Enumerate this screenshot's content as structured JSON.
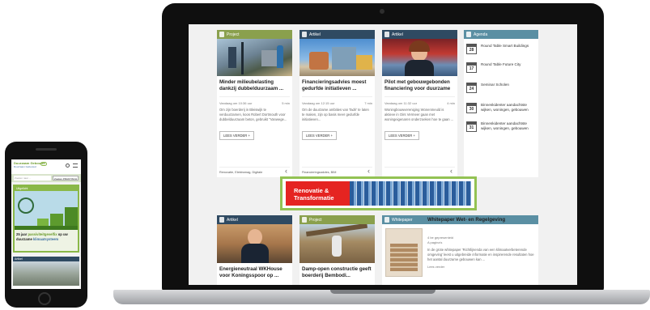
{
  "laptop": {
    "cards": [
      {
        "type": "Project",
        "head_color": "#8aa04d",
        "title": "Minder milieubelasting dankzij dubbelduurzaam ...",
        "date": "Vandaag om 10:36 uur",
        "read_time": "5 min",
        "text": "Om zijn boerderij in Bleiswijk te verduurzamen, koos Robert Dortmouth voor dubbelduurzaam  beton, gebruikt \"Vanwege...",
        "button": "LEES VERDER +",
        "tags": "Renovatie, Elektromag, Digitale"
      },
      {
        "type": "Artikel",
        "head_color": "#2f4a62",
        "title": "Financieringsadvies moest gedurfde initiatieven ...",
        "date": "Vandaag om 12:15 uur",
        "read_time": "7 min",
        "text": "Om de duurzame ambities van Tadri' te laten te maken, zijn op basis meer gedurfde initiatieven...",
        "button": "LEES VERDER +",
        "tags": "Financieringsadvies, BIM"
      },
      {
        "type": "Artikel",
        "head_color": "#2f4a62",
        "title": "Pilot met gebouwgebonden financiering voor duurzame ...",
        "date": "Vandaag om 11:32 uur",
        "read_time": "4 min",
        "text": "Woningbouwvereniging Wonenmeuld is aktieve in Oirs Vermeer gaan met woningeigenaren onderzoeken hoe te gaan ...",
        "button": "LEES VERDER +",
        "tags": ""
      }
    ],
    "agenda": {
      "label": "Agenda",
      "head_color": "#5a8fa3",
      "items": [
        {
          "day": "28",
          "text": "Round Table Smart Buildings"
        },
        {
          "day": "17",
          "text": "Round Table Future City"
        },
        {
          "day": "24",
          "text": "Seminar Scholen"
        },
        {
          "day": "30",
          "text": "Binnenkidenter aandachtste wijken, woningen, gebouwen"
        },
        {
          "day": "31",
          "text": "Binnenkidenter aandachtste wijken, woningen, gebouwen"
        }
      ]
    },
    "banner": {
      "line1": "Renovatie &",
      "line2": "Transformatie"
    },
    "bottom_cards": [
      {
        "type": "Artikel",
        "head_color": "#2f4a62",
        "title": "Energieneutraal WKHouse voor Koningsspoor op ..."
      },
      {
        "type": "Project",
        "head_color": "#8aa04d",
        "title": "Damp-open constructie geeft boerderij Bembodi..."
      }
    ],
    "whitepaper": {
      "type": "Whitepaper",
      "head_color": "#5a8fa3",
      "title": "Whitepaper Wet- en Regelgeving",
      "meta1": "4 be gepresenteid",
      "meta2": "A pagina's",
      "text": "In de grote whitepaper 'Richtlijnenda van een klimaatverbeterende omgeving' leest u uitgebreide informatie en inspirerende resultaten hoe het aantal duurzame gebouwen kan ...",
      "text2": "Lees verder"
    }
  },
  "phone": {
    "logo_top": "Duurzaam Gebouwd",
    "logo_sub": "Duurzaam Gebouwd",
    "search_placeholder": "Zoeken naar ...",
    "search_button": "Zoeken PRAKTISCH",
    "section_label": "Uitgelicht",
    "promo_text_plain": "25 jaar ",
    "promo_text_green": "passiviteit",
    "promo_text_3": "gevelfix ",
    "promo_text_4": "op",
    "promo_text_5": "uw duurzame",
    "promo_text_6": " klimaatsysteem",
    "article_label": "Artikel"
  }
}
